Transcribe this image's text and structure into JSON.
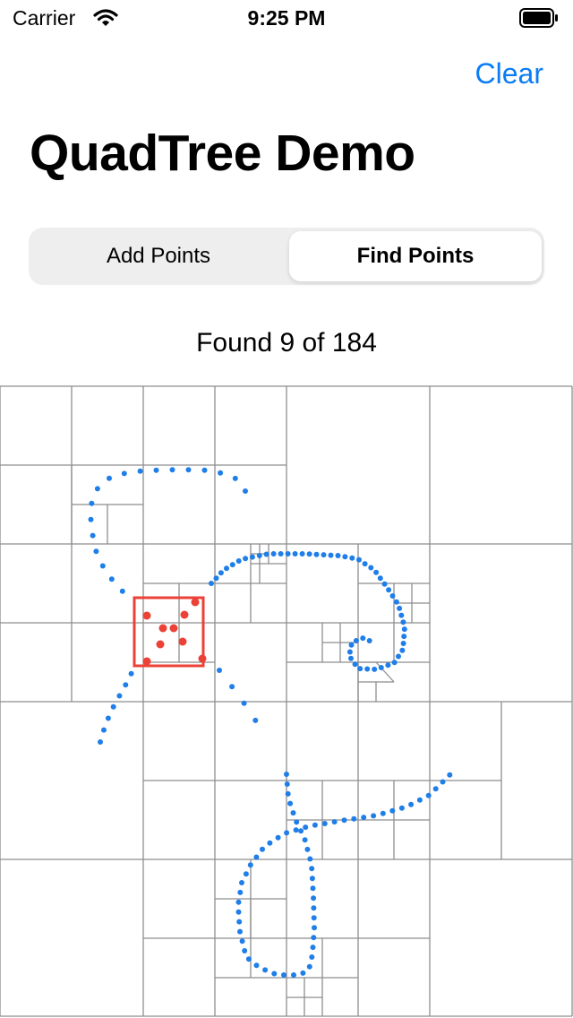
{
  "status_bar": {
    "carrier": "Carrier",
    "time": "9:25 PM"
  },
  "nav": {
    "clear_label": "Clear"
  },
  "title": "QuadTree Demo",
  "segmented": {
    "options": [
      "Add Points",
      "Find Points"
    ],
    "selected": "Find Points"
  },
  "result_text": "Found 9 of 184",
  "colors": {
    "accent": "#0a7cf5",
    "point": "#1f7ee8",
    "found": "#ec4136",
    "grid": "#8e8e8e"
  }
}
